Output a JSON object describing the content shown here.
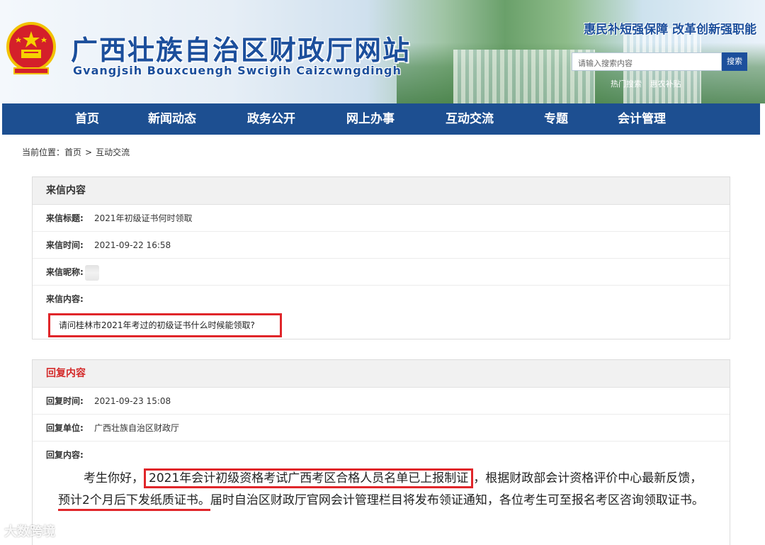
{
  "header": {
    "title": "广西壮族自治区财政厅网站",
    "subtitle": "Gvangjsih Bouxcuengh Swcigih Caizcwngdingh",
    "slogan": "惠民补短强保障 改革创新强职能",
    "search": {
      "placeholder": "请输入搜索内容",
      "button": "搜索"
    },
    "hotwords": [
      "热门搜索",
      "惠农补贴"
    ]
  },
  "nav": {
    "items": [
      {
        "label": "首页"
      },
      {
        "label": "新闻动态"
      },
      {
        "label": "政务公开"
      },
      {
        "label": "网上办事"
      },
      {
        "label": "互动交流"
      },
      {
        "label": "专题"
      },
      {
        "label": "会计管理"
      }
    ]
  },
  "breadcrumb": {
    "prefix": "当前位置：",
    "items": [
      "首页",
      "互动交流"
    ],
    "separator": ">"
  },
  "letter": {
    "heading": "来信内容",
    "title_label": "来信标题:",
    "title_value": "2021年初级证书何时领取",
    "time_label": "来信时间:",
    "time_value": "2021-09-22 16:58",
    "nickname_label": "来信昵称:",
    "content_label": "来信内容:",
    "content_value": "请问桂林市2021年考过的初级证书什么时候能领取?"
  },
  "reply": {
    "heading": "回复内容",
    "time_label": "回复时间:",
    "time_value": "2021-09-23 15:08",
    "unit_label": "回复单位:",
    "unit_value": "广西壮族自治区财政厅",
    "content_label": "回复内容:",
    "text_part1": "考生你好，",
    "text_highlight1": "2021年会计初级资格考试广西考区合格人员名单已上报制证",
    "text_part2": "，根据财政部会计资格评价中心最新反馈，",
    "text_highlight2": "预计2个月后下发纸质证书。",
    "text_part3": "届时自治区财政厅官网会计管理栏目将发布领证通知，各位考生可至报名考区咨询领取证书。"
  },
  "watermark": "大数跨境",
  "colors": {
    "nav_bg": "#1d4f91",
    "title_blue": "#1c4f9c",
    "highlight_red": "#e0262a",
    "reply_head_red": "#d42a2a"
  }
}
